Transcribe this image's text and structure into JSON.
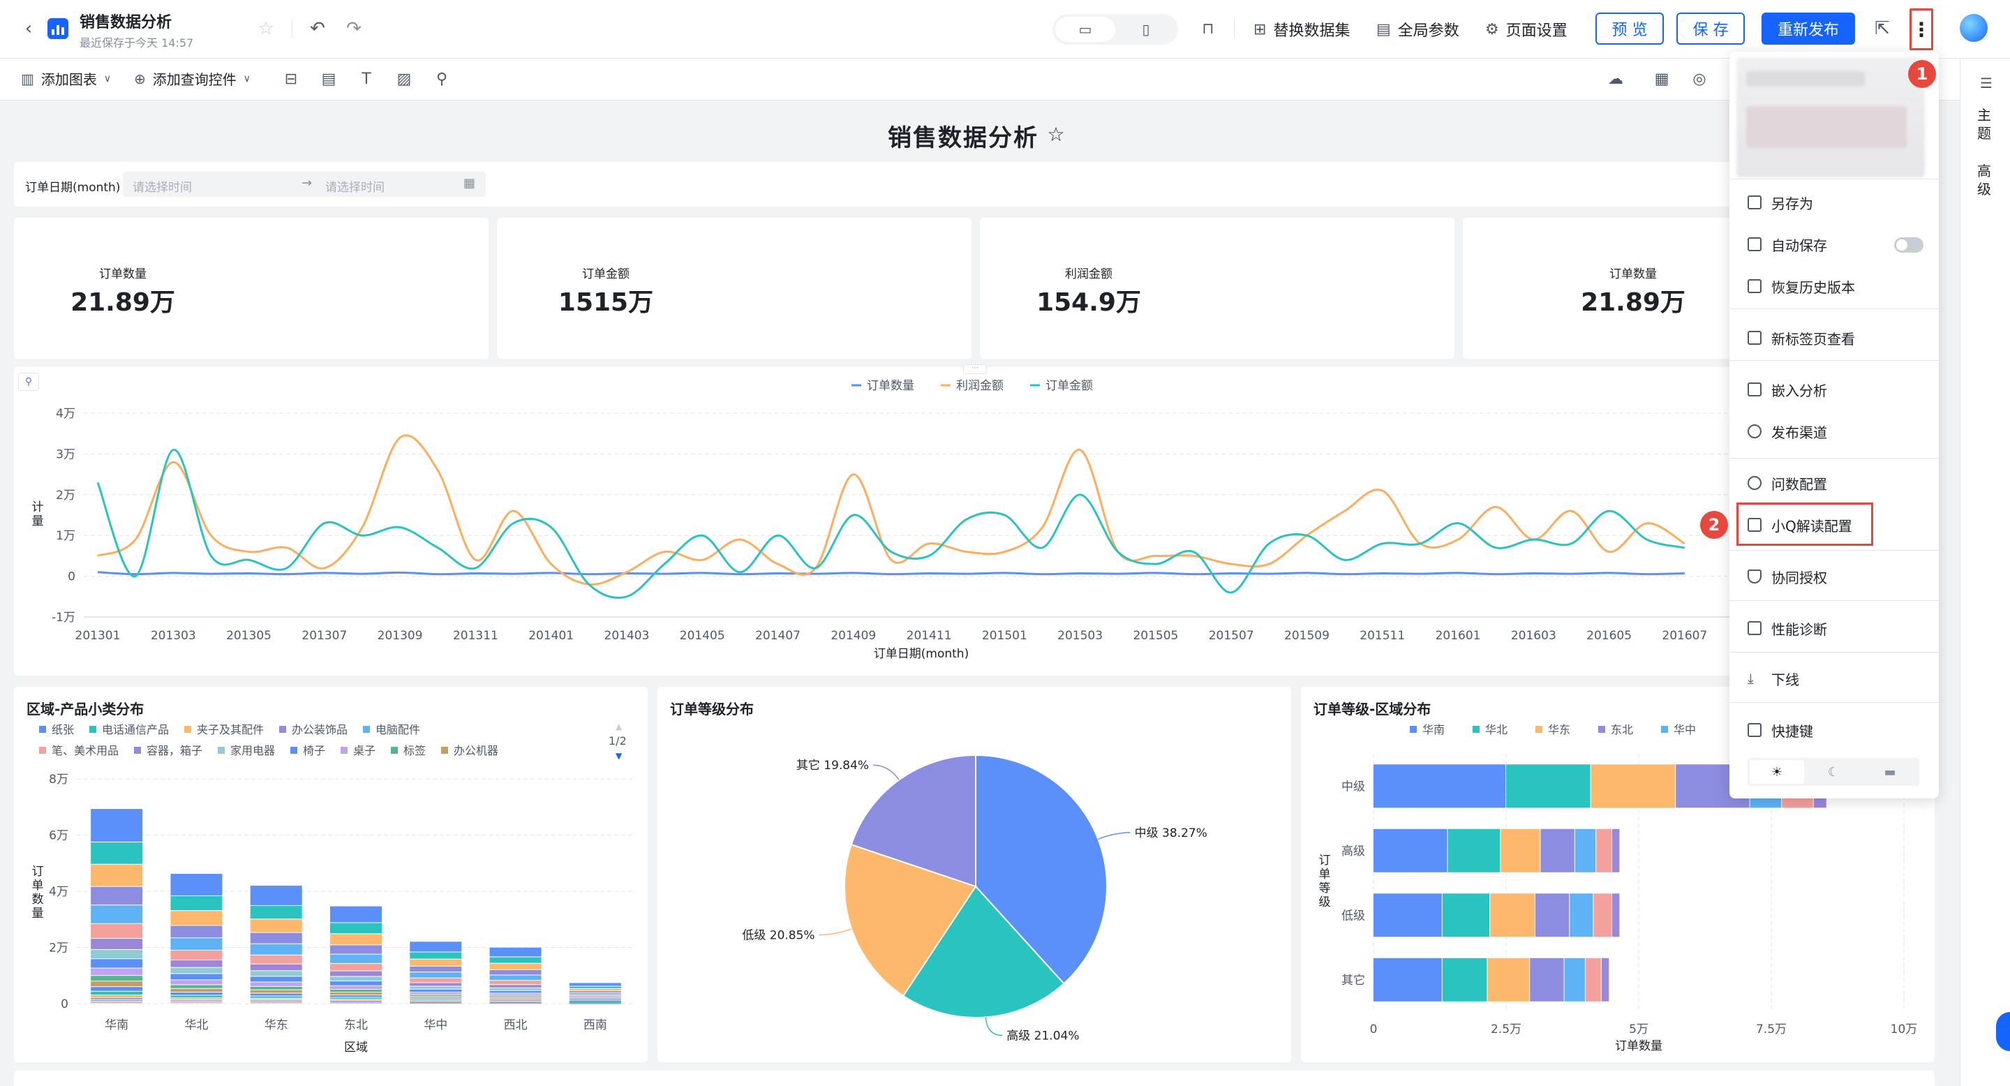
{
  "header": {
    "title": "销售数据分析",
    "subtitle": "最近保存于今天 14:57",
    "actions": {
      "replace_dataset": "替换数据集",
      "global_params": "全局参数",
      "page_settings": "页面设置",
      "preview": "预 览",
      "save": "保 存",
      "republish": "重新发布"
    }
  },
  "toolbar": {
    "add_chart": "添加图表",
    "add_query_control": "添加查询控件"
  },
  "page": {
    "title": "销售数据分析",
    "filter": {
      "label": "订单日期(month)",
      "start_placeholder": "请选择时间",
      "end_placeholder": "请选择时间"
    }
  },
  "kpis": [
    {
      "label": "订单数量",
      "value": "21.89万"
    },
    {
      "label": "订单金额",
      "value": "1515万"
    },
    {
      "label": "利润金额",
      "value": "154.9万"
    },
    {
      "label": "订单数量",
      "value": "21.89万"
    }
  ],
  "line_chart": {
    "legend": [
      "订单数量",
      "利润金额",
      "订单金额"
    ],
    "ylabel": "计量",
    "xlabel": "订单日期(month)",
    "yticks": [
      "4万",
      "3万",
      "2万",
      "1万",
      "0",
      "-1万"
    ],
    "xticks": [
      "201301",
      "201303",
      "201305",
      "201307",
      "201309",
      "201311",
      "201401",
      "201403",
      "201405",
      "201407",
      "201409",
      "201411",
      "201501",
      "201503",
      "201505",
      "201507",
      "201509",
      "201511",
      "201601",
      "201603",
      "201605",
      "201607"
    ]
  },
  "bar_panel": {
    "title": "区域-产品小类分布",
    "legend_row1": [
      "纸张",
      "电话通信产品",
      "夹子及其配件",
      "办公装饰品",
      "电脑配件"
    ],
    "legend_row2": [
      "笔、美术用品",
      "容器，箱子",
      "家用电器",
      "椅子",
      "桌子",
      "标签",
      "办公机器"
    ],
    "pager": "1/2",
    "yticks": [
      "8万",
      "6万",
      "4万",
      "2万",
      "0"
    ],
    "ylabel": "订单数量",
    "xlabel": "区域",
    "categories": [
      "华南",
      "华北",
      "华东",
      "东北",
      "华中",
      "西北",
      "西南"
    ]
  },
  "pie_panel": {
    "title": "订单等级分布",
    "labels": [
      "中级 38.27%",
      "高级 21.04%",
      "低级 20.85%",
      "其它 19.84%"
    ]
  },
  "hbar_panel": {
    "title": "订单等级-区域分布",
    "legend": [
      "华南",
      "华北",
      "华东",
      "东北",
      "华中"
    ],
    "categories": [
      "中级",
      "高级",
      "低级",
      "其它"
    ],
    "ylabel": "订单等级",
    "xlabel": "订单数量",
    "xticks": [
      "0",
      "2.5万",
      "5万",
      "7.5万",
      "10万"
    ]
  },
  "menu": {
    "items": [
      "另存为",
      "自动保存",
      "恢复历史版本",
      "新标签页查看",
      "嵌入分析",
      "发布渠道",
      "问数配置",
      "小Q解读配置",
      "协同授权",
      "性能诊断",
      "下线",
      "快捷键"
    ]
  },
  "annotations": {
    "step1": "1",
    "step2": "2"
  },
  "right_panel": {
    "theme": "主题",
    "advanced": "高级"
  },
  "chart_data": [
    {
      "type": "line",
      "x": [
        "201301",
        "201302",
        "201303",
        "201304",
        "201305",
        "201306",
        "201307",
        "201308",
        "201309",
        "201310",
        "201311",
        "201312",
        "201401",
        "201402",
        "201403",
        "201404",
        "201405",
        "201406",
        "201407",
        "201408",
        "201409",
        "201410",
        "201411",
        "201412",
        "201501",
        "201502",
        "201503",
        "201504",
        "201505",
        "201506",
        "201507",
        "201508",
        "201509",
        "201510",
        "201511",
        "201512",
        "201601",
        "201602",
        "201603",
        "201604",
        "201605",
        "201606",
        "201607"
      ],
      "series": [
        {
          "name": "订单数量",
          "color": "#5b8ff9",
          "values": [
            0.1,
            0.05,
            0.08,
            0.06,
            0.07,
            0.05,
            0.08,
            0.06,
            0.09,
            0.05,
            0.07,
            0.06,
            0.08,
            0.05,
            0.07,
            0.06,
            0.08,
            0.05,
            0.07,
            0.06,
            0.08,
            0.05,
            0.07,
            0.06,
            0.08,
            0.05,
            0.07,
            0.06,
            0.08,
            0.05,
            0.07,
            0.06,
            0.08,
            0.05,
            0.07,
            0.06,
            0.08,
            0.05,
            0.07,
            0.06,
            0.08,
            0.05,
            0.07
          ]
        },
        {
          "name": "利润金额",
          "color": "#fdad5c",
          "values": [
            0.5,
            0.9,
            2.8,
            1.0,
            0.6,
            0.7,
            0.2,
            1.2,
            3.4,
            2.6,
            0.4,
            1.6,
            0.3,
            -0.2,
            0.1,
            0.6,
            0.4,
            0.9,
            0.3,
            0.2,
            2.5,
            0.4,
            0.8,
            0.6,
            0.6,
            1.2,
            3.1,
            0.6,
            0.5,
            0.5,
            0.3,
            0.3,
            1.0,
            1.6,
            2.1,
            0.8,
            0.9,
            1.7,
            0.9,
            1.6,
            0.6,
            1.3,
            0.8
          ]
        },
        {
          "name": "订单金额",
          "color": "#2ac4c0",
          "values": [
            2.3,
            0.0,
            3.1,
            0.5,
            0.4,
            0.2,
            1.3,
            1.0,
            1.2,
            0.7,
            0.2,
            1.3,
            1.2,
            -0.2,
            -0.5,
            0.3,
            1.0,
            0.1,
            1.0,
            0.2,
            1.5,
            0.6,
            0.5,
            1.4,
            1.5,
            0.7,
            2.0,
            0.6,
            0.3,
            0.6,
            -0.4,
            0.8,
            1.0,
            0.4,
            0.8,
            0.8,
            1.3,
            0.7,
            0.9,
            0.8,
            1.6,
            0.9,
            0.7
          ]
        }
      ],
      "xlabel": "订单日期(month)",
      "ylabel": "计量",
      "ylim": [
        -1,
        4
      ]
    },
    {
      "type": "bar",
      "categories": [
        "华南",
        "华北",
        "华东",
        "东北",
        "华中",
        "西北",
        "西南"
      ],
      "values": [
        6.6,
        4.4,
        4.0,
        3.3,
        2.1,
        1.9,
        0.7
      ],
      "ylim": [
        0,
        8
      ],
      "ylabel": "订单数量",
      "xlabel": "区域"
    },
    {
      "type": "pie",
      "categories": [
        "中级",
        "高级",
        "低级",
        "其它"
      ],
      "values": [
        38.27,
        21.04,
        20.85,
        19.84
      ],
      "colors": [
        "#5b8ff9",
        "#2ac4c0",
        "#fdb86b",
        "#8c8ce0"
      ]
    },
    {
      "type": "bar",
      "categories": [
        "中级",
        "高级",
        "低级",
        "其它"
      ],
      "series": [
        {
          "name": "华南",
          "values": [
            2.5,
            1.4,
            1.3,
            1.3
          ]
        },
        {
          "name": "华北",
          "values": [
            1.6,
            1.0,
            0.9,
            0.85
          ]
        },
        {
          "name": "华东",
          "values": [
            1.6,
            0.75,
            0.85,
            0.8
          ]
        },
        {
          "name": "东北",
          "values": [
            1.4,
            0.65,
            0.65,
            0.65
          ]
        },
        {
          "name": "华中",
          "values": [
            0.6,
            0.4,
            0.45,
            0.4
          ]
        },
        {
          "name": "西北",
          "values": [
            0.6,
            0.3,
            0.35,
            0.3
          ]
        },
        {
          "name": "西南",
          "values": [
            0.25,
            0.15,
            0.15,
            0.15
          ]
        }
      ],
      "xlim": [
        0,
        10
      ],
      "xlabel": "订单数量",
      "ylabel": "订单等级"
    }
  ],
  "colors": {
    "primary": "#1664ff",
    "highlight": "#e8473e",
    "palette": [
      "#5b8ff9",
      "#2ac4c0",
      "#fdb86b",
      "#8c8ce0",
      "#5db3f6",
      "#f4a09c",
      "#9a87d8",
      "#8fcbd6",
      "#5b8ff9",
      "#c1a3f2",
      "#53b68d",
      "#c89b63"
    ]
  }
}
